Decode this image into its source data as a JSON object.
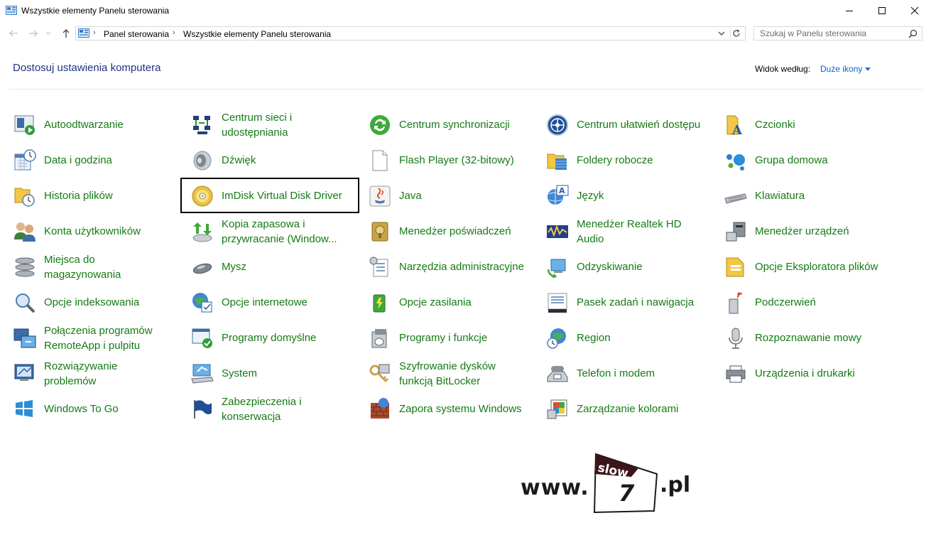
{
  "window": {
    "title": "Wszystkie elementy Panelu sterowania",
    "controls": [
      "minimize-icon",
      "maximize-icon",
      "close-icon"
    ]
  },
  "navigation": {
    "breadcrumb": [
      "Panel sterowania",
      "Wszystkie elementy Panelu sterowania"
    ],
    "search_placeholder": "Szukaj w Panelu sterowania"
  },
  "header": {
    "title": "Dostosuj ustawienia komputera",
    "view_by_label": "Widok według:",
    "view_by_value": "Duże ikony"
  },
  "items": [
    [
      "Autoodtwarzanie",
      "Centrum sieci i udostępniania",
      "Centrum synchronizacji",
      "Centrum ułatwień dostępu",
      "Czcionki"
    ],
    [
      "Data i godzina",
      "Dźwięk",
      "Flash Player (32-bitowy)",
      "Foldery robocze",
      "Grupa domowa"
    ],
    [
      "Historia plików",
      "ImDisk Virtual Disk Driver",
      "Java",
      "Język",
      "Klawiatura"
    ],
    [
      "Konta użytkowników",
      "Kopia zapasowa i przywracanie (Window...",
      "Menedżer poświadczeń",
      "Menedżer Realtek HD Audio",
      "Menedżer urządzeń"
    ],
    [
      "Miejsca do magazynowania",
      "Mysz",
      "Narzędzia administracyjne",
      "Odzyskiwanie",
      "Opcje Eksploratora plików"
    ],
    [
      "Opcje indeksowania",
      "Opcje internetowe",
      "Opcje zasilania",
      "Pasek zadań i nawigacja",
      "Podczerwień"
    ],
    [
      "Połączenia programów RemoteApp i pulpitu",
      "Programy domyślne",
      "Programy i funkcje",
      "Region",
      "Rozpoznawanie mowy"
    ],
    [
      "Rozwiązywanie problemów",
      "System",
      "Szyfrowanie dysków funkcją BitLocker",
      "Telefon i modem",
      "Urządzenia i drukarki"
    ],
    [
      "Windows To Go",
      "Zabezpieczenia i konserwacja",
      "Zapora systemu Windows",
      "Zarządzanie kolorami",
      ""
    ]
  ],
  "two_line": {
    "0-1": [
      "Centrum sieci i",
      "udostępniania"
    ],
    "3-1": [
      "Kopia zapasowa i",
      "przywracanie (Window..."
    ],
    "3-3": [
      "Menedżer Realtek HD",
      "Audio"
    ],
    "4-0": [
      "Miejsca do",
      "magazynowania"
    ],
    "6-0": [
      "Połączenia programów",
      "RemoteApp i pulpitu"
    ],
    "7-0": [
      "Rozwiązywanie",
      "problemów"
    ],
    "7-2": [
      "Szyfrowanie dysków",
      "funkcją BitLocker"
    ],
    "8-1": [
      "Zabezpieczenia i",
      "konserwacja"
    ]
  },
  "highlighted_item": "ImDisk Virtual Disk Driver",
  "watermark": {
    "prefix": "www.",
    "badge_top": "slow",
    "badge_number": "7",
    "suffix": ".pl"
  },
  "colors": {
    "link_green": "#157a15",
    "heading_blue": "#1e3287",
    "link_blue": "#0066cc"
  }
}
